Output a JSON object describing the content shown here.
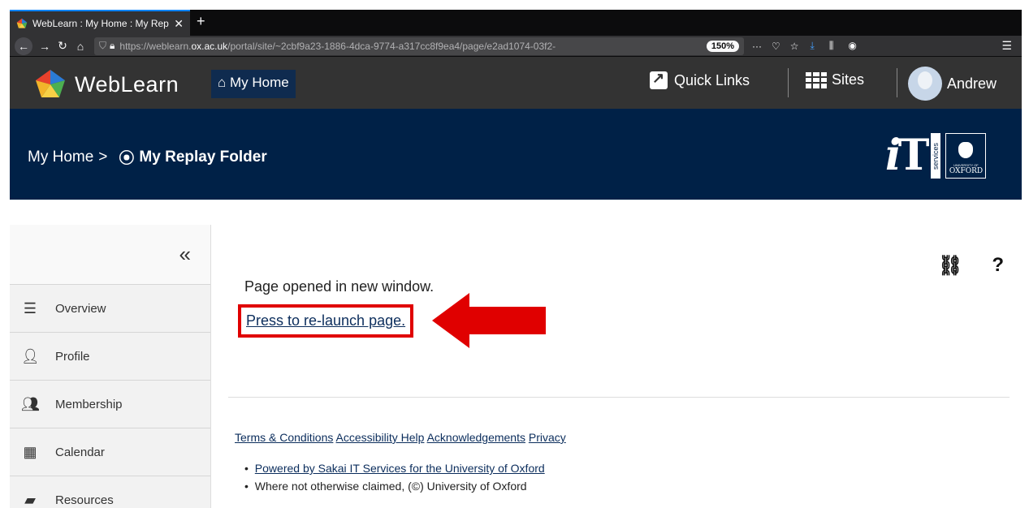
{
  "browser": {
    "tab_title": "WebLearn : My Home : My Repl",
    "tab_close": "✕",
    "new_tab": "+",
    "url_prefix": "https://weblearn.",
    "url_domain": "ox.ac.uk",
    "url_rest": "/portal/site/~2cbf9a23-1886-4dca-9774-a317cc8f9ea4/page/e2ad1074-03f2-",
    "zoom": "150%"
  },
  "header": {
    "logo_text": "WebLearn",
    "my_home": "My Home",
    "quick_links": "Quick Links",
    "sites": "Sites",
    "user_name": "Andrew"
  },
  "breadcrumb": {
    "root": "My Home",
    "separator": ">",
    "current": "My Replay Folder"
  },
  "it_logo": {
    "services": "services",
    "university_small": "UNIVERSITY OF",
    "oxford": "OXFORD"
  },
  "sidebar": {
    "collapse": "«",
    "items": [
      {
        "label": "Overview",
        "icon": "list-icon"
      },
      {
        "label": "Profile",
        "icon": "person-icon"
      },
      {
        "label": "Membership",
        "icon": "group-icon"
      },
      {
        "label": "Calendar",
        "icon": "calendar-icon"
      },
      {
        "label": "Resources",
        "icon": "folder-icon"
      }
    ]
  },
  "main": {
    "opened_text": "Page opened in new window.",
    "relaunch_link": "Press to re-launch page.",
    "help": "?"
  },
  "footer": {
    "links": [
      "Terms & Conditions",
      "Accessibility Help",
      "Acknowledgements",
      "Privacy"
    ],
    "powered": "Powered by Sakai IT Services for the University of Oxford",
    "copyright": "Where not otherwise claimed, (©) University of Oxford"
  },
  "colors": {
    "header_bg": "#333333",
    "band_bg": "#002147",
    "highlight_red": "#e00000"
  }
}
